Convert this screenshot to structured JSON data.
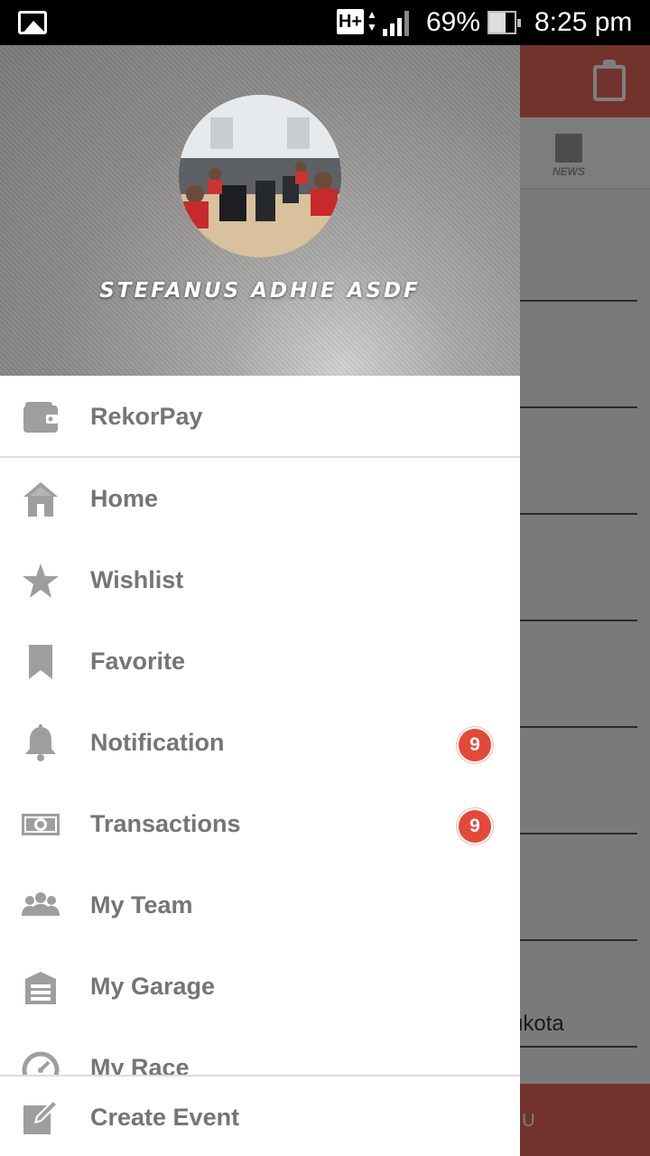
{
  "status_bar": {
    "network": "H+",
    "network_arrows": "▲▼",
    "battery_percent": "69%",
    "battery_level": 0.69,
    "time": "8:25 pm",
    "icons": [
      "gallery-icon",
      "signal-icon",
      "battery-icon"
    ]
  },
  "background_app": {
    "tab_label": "NEWS",
    "partial_text": "ukota",
    "bottom_button_partial": "LU",
    "accent_color": "#e5675a"
  },
  "drawer": {
    "user_name": "STEFANUS ADHIE ASDF",
    "top_item": {
      "label": "RekorPay",
      "icon": "wallet-icon"
    },
    "items": [
      {
        "label": "Home",
        "icon": "home-icon"
      },
      {
        "label": "Wishlist",
        "icon": "star-icon"
      },
      {
        "label": "Favorite",
        "icon": "bookmark-icon"
      },
      {
        "label": "Notification",
        "icon": "bell-icon",
        "badge": "9"
      },
      {
        "label": "Transactions",
        "icon": "money-icon",
        "badge": "9"
      },
      {
        "label": "My Team",
        "icon": "team-icon"
      },
      {
        "label": "My Garage",
        "icon": "garage-icon"
      },
      {
        "label": "My Race",
        "icon": "speedometer-icon"
      }
    ],
    "footer_item": {
      "label": "Create Event",
      "icon": "edit-icon"
    },
    "badge_color": "#e44839",
    "text_color": "#757575"
  }
}
